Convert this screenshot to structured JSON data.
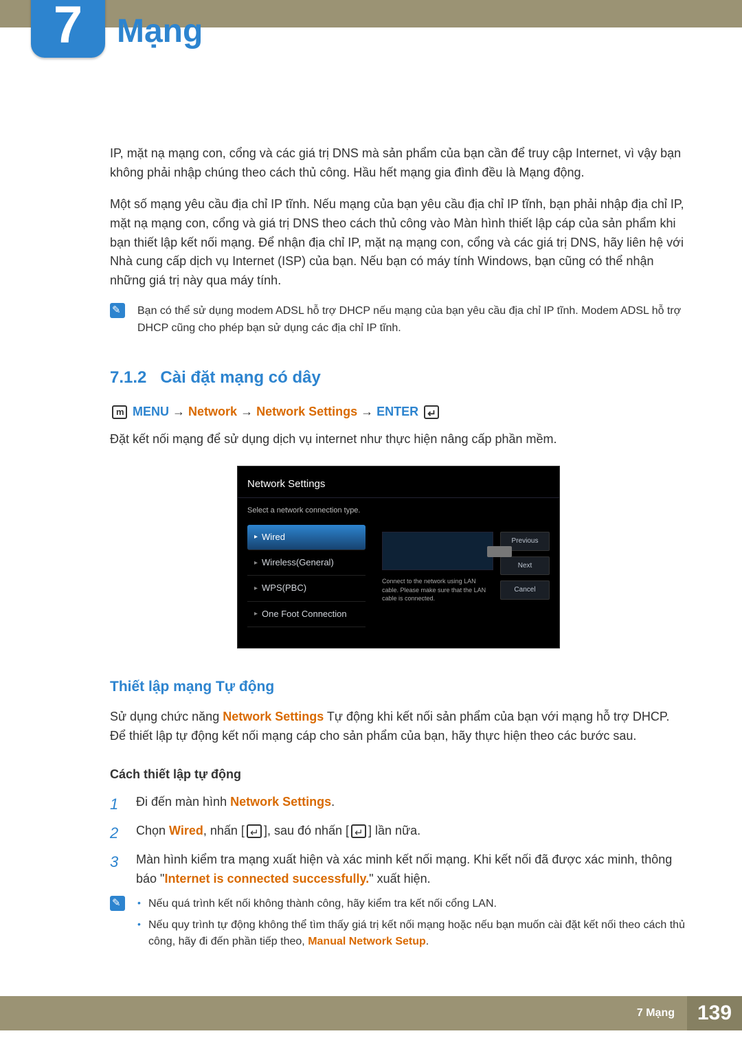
{
  "chapter_number": "7",
  "chapter_title": "Mạng",
  "para1": "IP, mặt nạ mạng con, cổng và các giá trị DNS mà sản phẩm của bạn cần để truy cập Internet, vì vậy bạn không phải nhập chúng theo cách thủ công. Hầu hết mạng gia đình đều là Mạng động.",
  "para2": "Một số mạng yêu cầu địa chỉ IP tĩnh. Nếu mạng của bạn yêu cầu địa chỉ IP tĩnh, bạn phải nhập địa chỉ IP, mặt nạ mạng con, cổng và giá trị DNS theo cách thủ công vào Màn hình thiết lập cáp của sản phẩm khi bạn thiết lập kết nối mạng. Để nhận địa chỉ IP, mặt nạ mạng con, cổng và các giá trị DNS, hãy liên hệ với Nhà cung cấp dịch vụ Internet (ISP) của bạn. Nếu bạn có máy tính Windows, bạn cũng có thể nhận những giá trị này qua máy tính.",
  "note1": "Bạn có thể sử dụng modem ADSL hỗ trợ DHCP nếu mạng của bạn yêu cầu địa chỉ IP tĩnh. Modem ADSL hỗ trợ DHCP cũng cho phép bạn sử dụng các địa chỉ IP tĩnh.",
  "sec712_number": "7.1.2",
  "sec712_title": "Cài đặt mạng có dây",
  "menu_path": {
    "menu": "MENU",
    "p1": "Network",
    "p2": "Network Settings",
    "enter": "ENTER"
  },
  "after_menu": "Đặt kết nối mạng để sử dụng dịch vụ internet như thực hiện nâng cấp phần mềm.",
  "ui": {
    "title": "Network Settings",
    "subtitle": "Select a network connection type.",
    "options": [
      "Wired",
      "Wireless(General)",
      "WPS(PBC)",
      "One Foot Connection"
    ],
    "selected_index": 0,
    "connect_text": "Connect to the network using LAN cable. Please make sure that the LAN cable is connected.",
    "buttons": [
      "Previous",
      "Next",
      "Cancel"
    ]
  },
  "sec_auto_title": "Thiết lập mạng Tự động",
  "para_auto_pre": "Sử dụng chức năng ",
  "para_auto_hl": "Network Settings",
  "para_auto_post": " Tự động khi kết nối sản phẩm của bạn với mạng hỗ trợ DHCP. Để thiết lập tự động kết nối mạng cáp cho sản phẩm của bạn, hãy thực hiện theo các bước sau.",
  "sub_auto": "Cách thiết lập tự động",
  "steps": {
    "s1_pre": "Đi đến màn hình ",
    "s1_hl": "Network Settings",
    "s1_post": ".",
    "s2_pre": "Chọn ",
    "s2_hl": "Wired",
    "s2_mid": ", nhấn [",
    "s2_pre2": "], sau đó nhấn [",
    "s2_post": "] lần nữa.",
    "s3": "Màn hình kiểm tra mạng xuất hiện và xác minh kết nối mạng. Khi kết nối đã được xác minh, thông báo \"",
    "s3_hl": "Internet is connected successfully.",
    "s3_post": "\" xuất hiện."
  },
  "note2": {
    "b1": "Nếu quá trình kết nối không thành công, hãy kiểm tra kết nối cổng LAN.",
    "b2_pre": "Nếu quy trình tự động không thể tìm thấy giá trị kết nối mạng hoặc nếu bạn muốn cài đặt kết nối theo cách thủ công, hãy đi đến phần tiếp theo, ",
    "b2_hl": "Manual Network Setup",
    "b2_post": "."
  },
  "footer_label": "7 Mạng",
  "footer_page": "139"
}
